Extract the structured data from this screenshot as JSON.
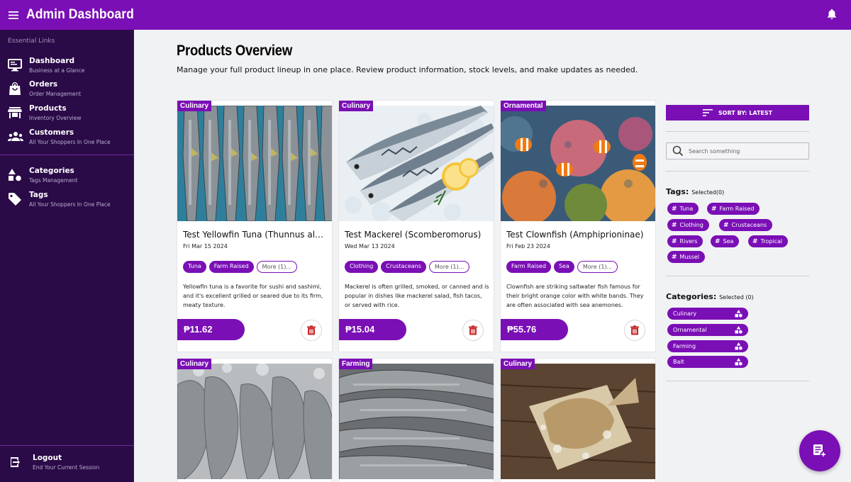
{
  "app": {
    "title": "Admin Dashboard"
  },
  "colors": {
    "brand": "#7a0fb5",
    "sidebar": "#2b0a48",
    "danger": "#c62828"
  },
  "sidebar": {
    "section_title": "Essential Links",
    "items": [
      {
        "label": "Dashboard",
        "sub": "Business at a Glance",
        "icon": "monitor-icon"
      },
      {
        "label": "Orders",
        "sub": "Order Management",
        "icon": "shopping-bag-icon"
      },
      {
        "label": "Products",
        "sub": "Inventory Overview",
        "icon": "store-icon"
      },
      {
        "label": "Customers",
        "sub": "All Your Shoppers In One Place",
        "icon": "people-icon"
      },
      {
        "label": "Categories",
        "sub": "Tags Management",
        "icon": "shapes-icon"
      },
      {
        "label": "Tags",
        "sub": "All Your Shoppers In One Place",
        "icon": "tag-icon"
      }
    ],
    "logout": {
      "label": "Logout",
      "sub": "End Your Current Session"
    }
  },
  "main": {
    "title": "Products Overview",
    "description": "Manage your full product lineup in one place. Review product information, stock levels, and make updates as needed."
  },
  "products": [
    {
      "category": "Culinary",
      "name": "Test Yellowfin Tuna (Thunnus albacares)",
      "date": "Fri Mar 15 2024",
      "tags": [
        "Tuna",
        "Farm Raised",
        "More (1)..."
      ],
      "description": "Yellowfin tuna is a favorite for sushi and sashimi, and it's excellent grilled or seared due to its firm, meaty texture.",
      "price": "₱11.62"
    },
    {
      "category": "Culinary",
      "name": "Test Mackerel (Scomberomorus)",
      "date": "Wed Mar 13 2024",
      "tags": [
        "Clothing",
        "Crustaceans",
        "More (1)..."
      ],
      "description": "Mackerel is often grilled, smoked, or canned and is popular in dishes like mackerel salad, fish tacos, or served with rice.",
      "price": "₱15.04"
    },
    {
      "category": "Ornamental",
      "name": "Test Clownfish (Amphiprioninae)",
      "date": "Fri Feb 23 2024",
      "tags": [
        "Farm Raised",
        "Sea",
        "More (1)..."
      ],
      "description": "Clownfish are striking saltwater fish famous for their bright orange color with white bands. They are often associated with sea anemones.",
      "price": "₱55.76"
    },
    {
      "category": "Culinary"
    },
    {
      "category": "Farming"
    },
    {
      "category": "Culinary"
    }
  ],
  "filters": {
    "sort_label": "SORT BY: LATEST",
    "search_placeholder": "Search something",
    "tags_heading": "Tags:",
    "tags_selected": "Selected(0)",
    "tags": [
      "Tuna",
      "Farm Raised",
      "Clothing",
      "Crustaceans",
      "Rivers",
      "Sea",
      "Tropical",
      "Mussel"
    ],
    "categories_heading": "Categories:",
    "categories_selected": "Selected (0)",
    "categories": [
      "Culinary",
      "Ornamental",
      "Farming",
      "Bait"
    ]
  }
}
